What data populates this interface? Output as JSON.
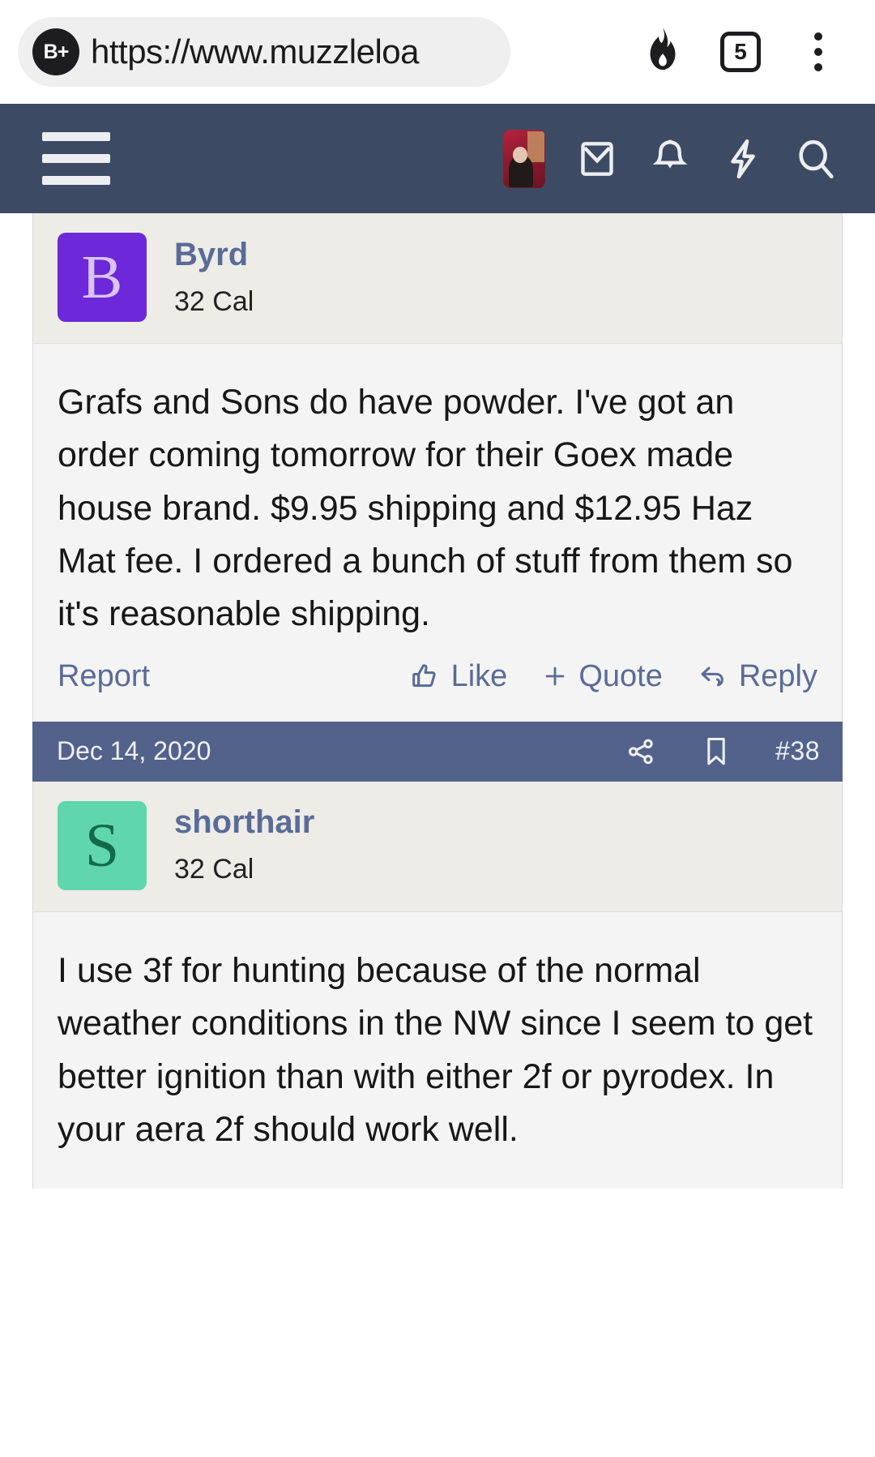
{
  "browser": {
    "url": "https://www.muzzleloa",
    "brave_badge": "B+",
    "shields_icon": "flame-icon",
    "tab_count": "5",
    "menu_icon": "kebab-menu-icon"
  },
  "site_header": {
    "menu_icon": "hamburger-menu-icon",
    "avatar_icon": "user-avatar-icon",
    "inbox_icon": "envelope-icon",
    "alerts_icon": "bell-icon",
    "whats_new_icon": "lightning-bolt-icon",
    "search_icon": "search-icon"
  },
  "posts": [
    {
      "username": "Byrd",
      "user_title": "32 Cal",
      "avatar_letter": "B",
      "avatar_bg": "#6d28d9",
      "avatar_fg": "#d8c4f5",
      "body_before": "Grafs and Sons do have powder. I've got an order coming tomorrow for their Goex made house brand. $9.95 shipping and ",
      "body_highlight": "$12.95 Haz Mat fee.",
      "body_after": " I ordered a bunch of stuff from them so it's reasonable shipping.",
      "actions": {
        "report": "Report",
        "like": "Like",
        "quote": "Quote",
        "reply": "Reply"
      }
    },
    {
      "username": "shorthair",
      "user_title": "32 Cal",
      "avatar_letter": "S",
      "avatar_bg": "#5fd6ad",
      "avatar_fg": "#136a4b",
      "body": "I use 3f for hunting because of the normal weather conditions in the NW since I seem to get better ignition than with either 2f or pyrodex. In your aera 2f should work well."
    }
  ],
  "post_meta": {
    "date": "Dec 14, 2020",
    "share_icon": "share-icon",
    "bookmark_icon": "bookmark-icon",
    "post_number": "#38"
  },
  "colors": {
    "header_bg": "#3c4b63",
    "meta_bg": "#53628b",
    "link": "#5a6b96",
    "highlight": "#f46a64"
  }
}
